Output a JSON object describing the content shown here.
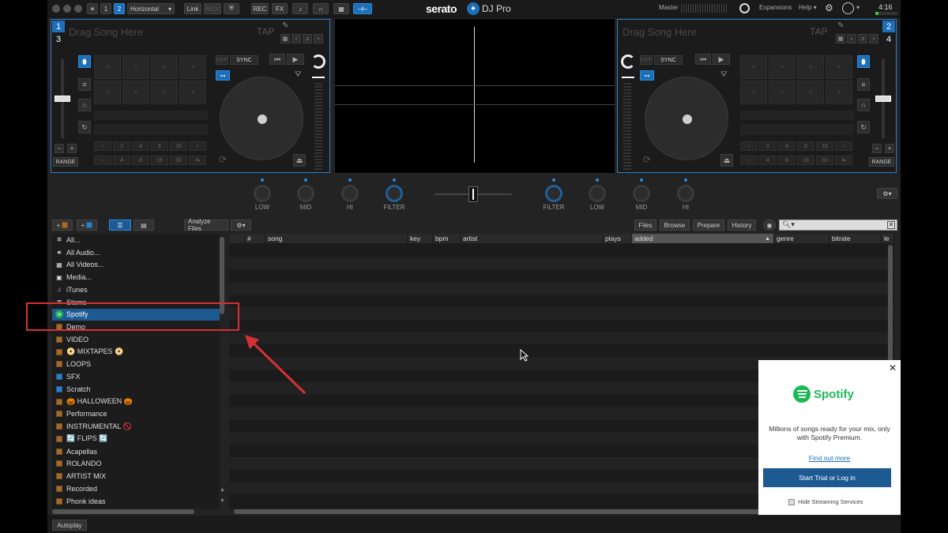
{
  "topbar": {
    "layout_select": "Horizontal",
    "deck_1": "1",
    "deck_2": "2",
    "link": "Link",
    "midi": "MIDI",
    "rec": "REC",
    "fx": "FX",
    "logo": "serato",
    "product": "DJ Pro",
    "master": "Master",
    "expansions": "Expansions",
    "help": "Help",
    "time": "4:16"
  },
  "deck_left": {
    "num_top": "1",
    "num_bottom": "3",
    "drag_text": "Drag Song Here",
    "tap": "TAP",
    "off": "OFF",
    "sync": "SYNC",
    "range": "RANGE",
    "loops_top": [
      "2",
      "4",
      "8",
      "16"
    ],
    "loops_bottom": [
      "4",
      "8",
      "16",
      "32"
    ]
  },
  "deck_right": {
    "num_top": "2",
    "num_bottom": "4",
    "drag_text": "Drag Song Here",
    "tap": "TAP",
    "off": "OFF",
    "sync": "SYNC",
    "range": "RANGE",
    "loops_top": [
      "2",
      "4",
      "8",
      "16"
    ],
    "loops_bottom": [
      "4",
      "8",
      "16",
      "32"
    ]
  },
  "mixer": {
    "left": [
      "LOW",
      "MID",
      "HI",
      "FILTER"
    ],
    "right": [
      "FILTER",
      "LOW",
      "MID",
      "HI"
    ]
  },
  "library_toolbar": {
    "analyze": "Analyze Files",
    "files": "Files",
    "browse": "Browse",
    "prepare": "Prepare",
    "history": "History"
  },
  "crates": [
    {
      "label": "All...",
      "icon": "gear-icon"
    },
    {
      "label": "All Audio...",
      "icon": "speaker-icon"
    },
    {
      "label": "All Videos...",
      "icon": "film-icon"
    },
    {
      "label": "Media...",
      "icon": "media-icon"
    },
    {
      "label": "iTunes",
      "icon": "itunes-icon"
    },
    {
      "label": "Stems",
      "icon": "stems-icon"
    },
    {
      "label": "Spotify",
      "icon": "spotify-icon"
    },
    {
      "label": "Demo",
      "icon": "crate-icon"
    },
    {
      "label": "VIDEO",
      "icon": "crate-icon"
    },
    {
      "label": "📀 MIXTAPES 📀",
      "icon": "crate-icon"
    },
    {
      "label": "LOOPS",
      "icon": "crate-icon"
    },
    {
      "label": "SFX",
      "icon": "crate-icon-blue"
    },
    {
      "label": "Scratch",
      "icon": "crate-icon-blue"
    },
    {
      "label": "🎃 HALLOWEEN 🎃",
      "icon": "crate-icon"
    },
    {
      "label": "Performance",
      "icon": "crate-icon"
    },
    {
      "label": "INSTRUMENTAL 🚫",
      "icon": "crate-icon"
    },
    {
      "label": "🔄 FLIPS 🔄",
      "icon": "crate-icon"
    },
    {
      "label": "Acapellas",
      "icon": "crate-icon"
    },
    {
      "label": "ROLANDO",
      "icon": "crate-icon"
    },
    {
      "label": "ARTIST MIX",
      "icon": "crate-icon"
    },
    {
      "label": "Recorded",
      "icon": "crate-icon"
    },
    {
      "label": "Phonk ideas",
      "icon": "crate-icon"
    }
  ],
  "columns": [
    "#",
    "song",
    "key",
    "bpm",
    "artist",
    "plays",
    "added",
    "genre",
    "bitrate",
    "le"
  ],
  "spotify_popup": {
    "brand": "Spotify",
    "text": "Millions of songs ready for your mix, only with Spotify Premium.",
    "link": "Find out more",
    "button": "Start Trial or Log in",
    "checkbox": "Hide Streaming Services"
  },
  "autoplay": "Autoplay",
  "colors": {
    "accent": "#1d6fb8",
    "spotify": "#1db954",
    "annotation": "#d63033"
  }
}
